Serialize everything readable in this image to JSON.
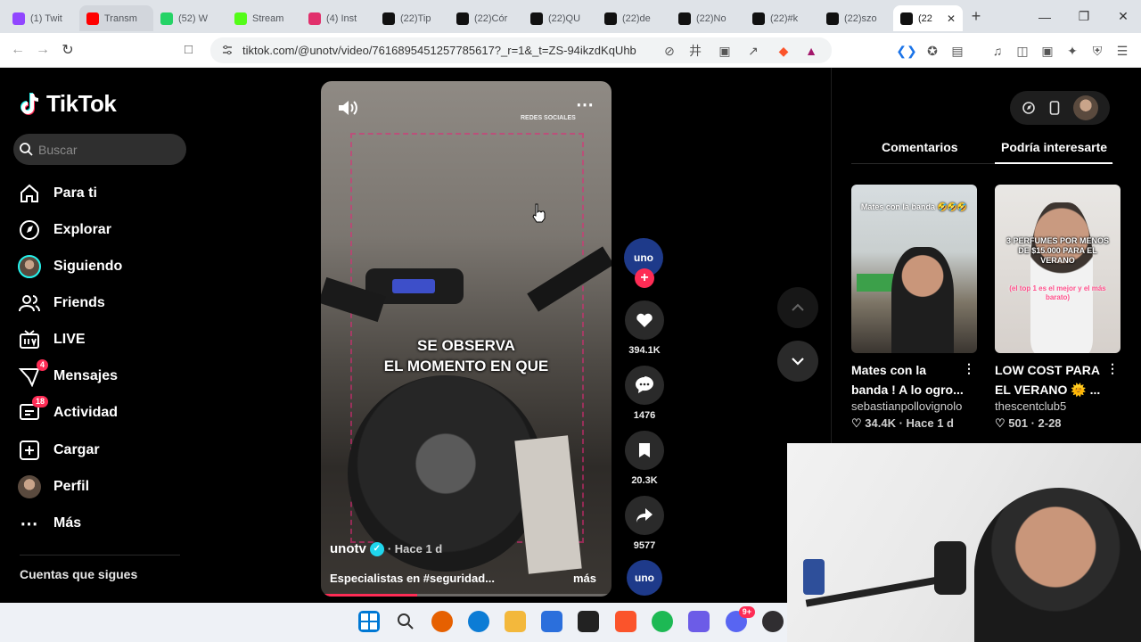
{
  "browser": {
    "tabs": [
      {
        "label": "(1) Twit",
        "icon": "twitch-icon",
        "color": "#9146ff"
      },
      {
        "label": "Transm",
        "icon": "youtube-icon",
        "color": "#ff0000"
      },
      {
        "label": "(52) W",
        "icon": "whatsapp-icon",
        "color": "#25d366"
      },
      {
        "label": "Stream",
        "icon": "kick-icon",
        "color": "#53fc18"
      },
      {
        "label": "(4) Inst",
        "icon": "instagram-icon",
        "color": "#e1306c"
      },
      {
        "label": "(22)Tip",
        "icon": "tiktok-icon",
        "color": "#111111"
      },
      {
        "label": "(22)Cór",
        "icon": "tiktok-icon",
        "color": "#111111"
      },
      {
        "label": "(22)QU",
        "icon": "tiktok-icon",
        "color": "#111111"
      },
      {
        "label": "(22)de",
        "icon": "tiktok-icon",
        "color": "#111111"
      },
      {
        "label": "(22)No",
        "icon": "tiktok-icon",
        "color": "#111111"
      },
      {
        "label": "(22)#k",
        "icon": "tiktok-icon",
        "color": "#111111"
      },
      {
        "label": "(22)szo",
        "icon": "tiktok-icon",
        "color": "#111111"
      }
    ],
    "active_tab": {
      "label": "(22",
      "icon": "tiktok-icon"
    },
    "url": "tiktok.com/@unotv/video/7616895451257785617?_r=1&_t=ZS-94ikzdKqUhb"
  },
  "tiktok": {
    "logo_text": "TikTok",
    "search_placeholder": "Buscar",
    "nav": [
      {
        "label": "Para ti",
        "icon": "home-icon",
        "badge": ""
      },
      {
        "label": "Explorar",
        "icon": "compass-icon",
        "badge": ""
      },
      {
        "label": "Siguiendo",
        "icon": "following-avatar-icon",
        "badge": ""
      },
      {
        "label": "Friends",
        "icon": "friends-icon",
        "badge": ""
      },
      {
        "label": "LIVE",
        "icon": "live-icon",
        "badge": ""
      },
      {
        "label": "Mensajes",
        "icon": "messages-icon",
        "badge": "4"
      },
      {
        "label": "Actividad",
        "icon": "activity-icon",
        "badge": "18"
      },
      {
        "label": "Cargar",
        "icon": "upload-icon",
        "badge": ""
      },
      {
        "label": "Perfil",
        "icon": "profile-avatar-icon",
        "badge": ""
      },
      {
        "label": "Más",
        "icon": "more-icon",
        "badge": ""
      }
    ],
    "following_section_title": "Cuentas que sigues"
  },
  "video": {
    "top_label": "REDES SOCIALES",
    "caption_line1": "SE OBSERVA",
    "caption_line2": "EL MOMENTO EN QUE",
    "author": "unotv",
    "time": "· Hace 1 d",
    "description": "Especialistas en #seguridad...",
    "more_label": "más",
    "progress_fraction": 0.33
  },
  "actions": {
    "creator_logo": "uno",
    "likes": "394.1K",
    "comments": "1476",
    "saves": "20.3K",
    "shares": "9577",
    "sound_logo": "uno"
  },
  "right_panel": {
    "tab_comments": "Comentarios",
    "tab_suggested": "Podría interesarte",
    "cards": [
      {
        "thumb_text": "Mates con la banda 🤣🤣🤣",
        "title": "Mates con la banda ! A lo ogro...",
        "author": "sebastianpollovignolo",
        "stats": "♡ 34.4K · Hace 1 d"
      },
      {
        "thumb_text": "3 PERFUMES POR MENOS DE $15.000 PARA EL VERANO",
        "thumb_text2": "(el top 1 es el mejor y el más barato)",
        "title": "LOW COST PARA EL VERANO 🌞 ...",
        "author": "thescentclub5",
        "stats": "♡ 501 · 2-28"
      }
    ]
  },
  "taskbar": {
    "apps": [
      {
        "icon": "windows-start-icon",
        "color": "#0078d4"
      },
      {
        "icon": "search-icon",
        "color": "#333333"
      },
      {
        "icon": "firefox-dev-icon",
        "color": "#e66000"
      },
      {
        "icon": "edge-icon",
        "color": "#0c7cd5"
      },
      {
        "icon": "file-explorer-icon",
        "color": "#f3b83c"
      },
      {
        "icon": "store-icon",
        "color": "#2b6fdc"
      },
      {
        "icon": "sticky-notes-icon",
        "color": "#222222"
      },
      {
        "icon": "brave-icon",
        "color": "#fb542b"
      },
      {
        "icon": "spotify-icon",
        "color": "#1db954"
      },
      {
        "icon": "vpn-icon",
        "color": "#6c5ce7"
      },
      {
        "icon": "discord-icon",
        "color": "#5865f2"
      },
      {
        "icon": "obs-icon",
        "color": "#302e31"
      }
    ],
    "discord_badge": "9+"
  }
}
